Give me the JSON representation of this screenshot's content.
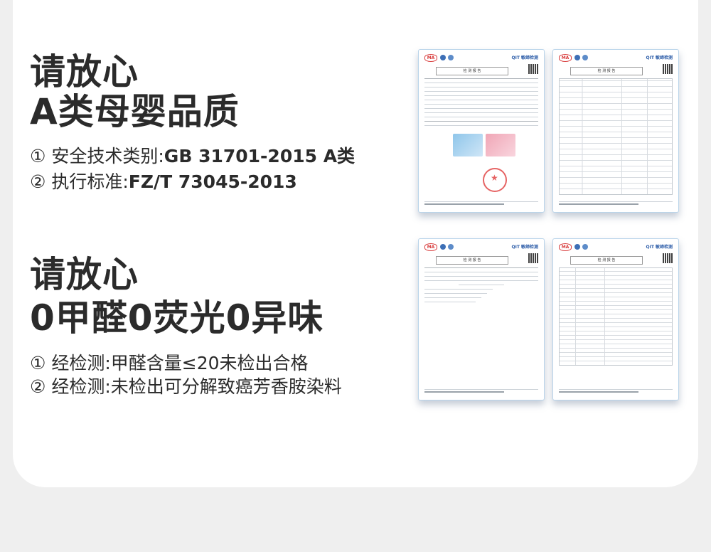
{
  "section1": {
    "headline_line1": "请放心",
    "headline_line2": "A类母婴品质",
    "bullet1_prefix": "① 安全技术类别:",
    "bullet1_value": "GB 31701-2015 A类",
    "bullet2_prefix": "② 执行标准:",
    "bullet2_value": "FZ/T 73045-2013"
  },
  "section2": {
    "headline_line1": "请放心",
    "headline_line2": "0甲醛0荧光0异味",
    "bullet1": "① 经检测:甲醛含量≤20未检出合格",
    "bullet2": "② 经检测:未检出可分解致癌芳香胺染料"
  },
  "certificates": {
    "ma_mark": "MA",
    "qit_mark": "QIT 敏缔检测",
    "report_title": "检 测 报 告"
  },
  "colors": {
    "headline": "#2b2b2b",
    "card": "#ffffff",
    "page_bg": "#efefef",
    "stamp": "#e24a4a",
    "sheet_border": "#b9d4ea"
  }
}
